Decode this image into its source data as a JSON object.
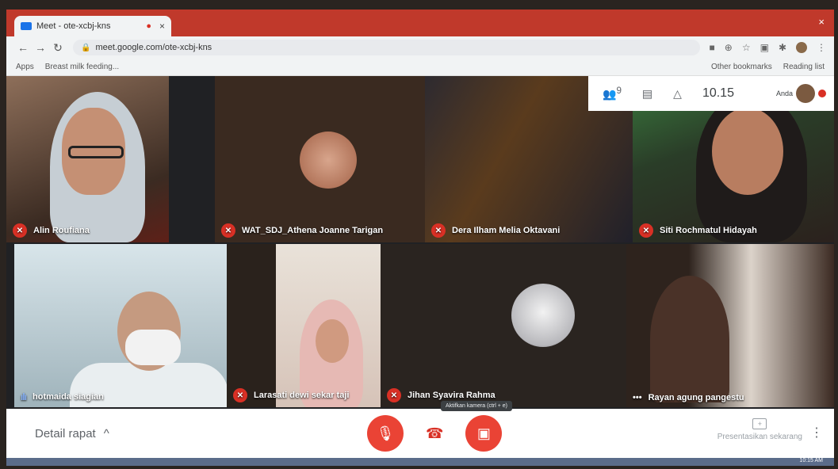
{
  "browser": {
    "tab_title": "Meet - ote-xcbj-kns",
    "tab_close": "×",
    "window_close": "×",
    "url": "meet.google.com/ote-xcbj-kns",
    "bookmarks": [
      "Apps",
      "Breast milk feeding..."
    ],
    "bookmarks_right": [
      "Other bookmarks",
      "Reading list"
    ]
  },
  "meet": {
    "participants_count": "9",
    "time": "10.15",
    "self_label": "Anda",
    "detail_label": "Detail rapat",
    "camera_tooltip": "Aktifkan kamera (ctrl + e)",
    "present_label": "Presentasikan sekarang",
    "tiles": [
      {
        "name": "Alin Roufiana",
        "status": "muted"
      },
      {
        "name": "WAT_SDJ_Athena Joanne Tarigan",
        "status": "muted"
      },
      {
        "name": "Dera Ilham Melia Oktavani",
        "status": "muted"
      },
      {
        "name": "Siti Rochmatul Hidayah",
        "status": "muted"
      },
      {
        "name": "hotmaida siagian",
        "status": "speaking"
      },
      {
        "name": "Larasati dewi sekar taji",
        "status": "muted"
      },
      {
        "name": "Jihan Syavira Rahma",
        "status": "muted"
      },
      {
        "name": "Rayan agung pangestu",
        "status": "more"
      }
    ]
  },
  "taskbar": {
    "clock": "10:15 AM"
  },
  "colors": {
    "tab_bar": "#c0392b",
    "mute_red": "#d93025",
    "control_red": "#ea4335"
  }
}
